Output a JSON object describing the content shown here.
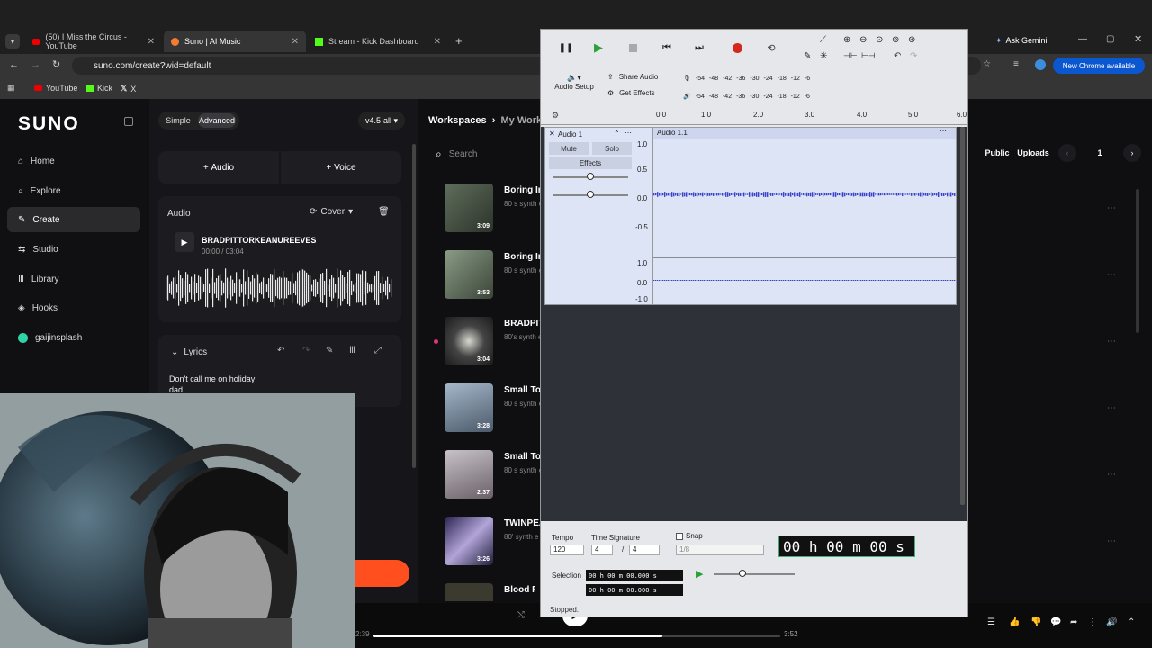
{
  "browser": {
    "tabs": [
      {
        "label": "(50) I Miss the Circus - YouTube",
        "active": false
      },
      {
        "label": "Suno | AI Music",
        "active": true
      },
      {
        "label": "Stream - Kick Dashboard",
        "active": false
      }
    ],
    "url": "suno.com/create?wid=default",
    "ask_gemini": "Ask Gemini",
    "chrome_update": "New Chrome available",
    "bookmarks": [
      "YouTube",
      "Kick",
      "X"
    ]
  },
  "suno": {
    "logo": "SUNO",
    "nav": [
      "Home",
      "Explore",
      "Create",
      "Studio",
      "Library",
      "Hooks",
      "gaijinsplash"
    ],
    "mode_simple": "Simple",
    "mode_advanced": "Advanced",
    "model": "v4.5-all",
    "add_audio": "Audio",
    "add_voice": "Voice",
    "audio_section": "Audio",
    "cover_label": "Cover",
    "clip_title": "BRADPITTORKEANUREEVES",
    "clip_time": "00:00 / 03:04",
    "lyrics_label": "Lyrics",
    "lyrics_text": "Don't call me on holiday",
    "lyrics_text2": "dad",
    "breadcrumb_root": "Workspaces",
    "breadcrumb_current": "My Worksp",
    "search_placeholder": "Search",
    "public_label": "Public",
    "uploads_label": "Uploads",
    "page_number": "1",
    "songs": [
      {
        "title": "Boring Im",
        "sub": "80 s synth e",
        "duration": "3:09"
      },
      {
        "title": "Boring Im",
        "sub": "80 s synth e",
        "duration": "3:53"
      },
      {
        "title": "BRADPIT",
        "sub": "80's synth e",
        "duration": "3:04"
      },
      {
        "title": "Small Tow",
        "sub": "80 s synth e",
        "duration": "3:28"
      },
      {
        "title": "Small Tow",
        "sub": "80 s synth e",
        "duration": "2:37"
      },
      {
        "title": "TWINPEA",
        "sub": "80' synth e",
        "duration": "3:26"
      },
      {
        "title": "Blood Red",
        "sub": "",
        "duration": ""
      }
    ],
    "player_elapsed": "2:39",
    "player_total": "3:52",
    "player_progress": 0.71
  },
  "audacity": {
    "share_audio": "Share Audio",
    "get_effects": "Get Effects",
    "audio_setup": "Audio Setup",
    "meter_ticks": [
      "-54",
      "-48",
      "-42",
      "-36",
      "-30",
      "-24",
      "-18",
      "-12",
      "-6"
    ],
    "ruler_ticks": [
      "0.0",
      "1.0",
      "2.0",
      "3.0",
      "4.0",
      "5.0",
      "6.0"
    ],
    "track_name": "Audio 1",
    "clip_name": "Audio 1.1",
    "mute": "Mute",
    "solo": "Solo",
    "effects": "Effects",
    "scale_top": [
      "1.0",
      "0.5",
      "0.0",
      "-0.5",
      "-1.0"
    ],
    "scale_bottom": [
      "1.0",
      "0.0",
      "-1.0"
    ],
    "tempo_label": "Tempo",
    "tempo_value": "120",
    "time_sig_label": "Time Signature",
    "time_sig_num": "4",
    "time_sig_den": "4",
    "snap_label": "Snap",
    "snap_value": "1/8",
    "big_time": "00 h 00 m 00 s",
    "selection_label": "Selection",
    "sel_start": "00 h 00 m 00.000 s",
    "sel_end": "00 h 00 m 00.000 s",
    "status": "Stopped."
  },
  "colors": {
    "accent_orange": "#ff4f1f",
    "record_red": "#d1281f",
    "play_green": "#2aa13a",
    "waveform_blue": "#3a42c8",
    "track_bg": "#dde4f5"
  }
}
